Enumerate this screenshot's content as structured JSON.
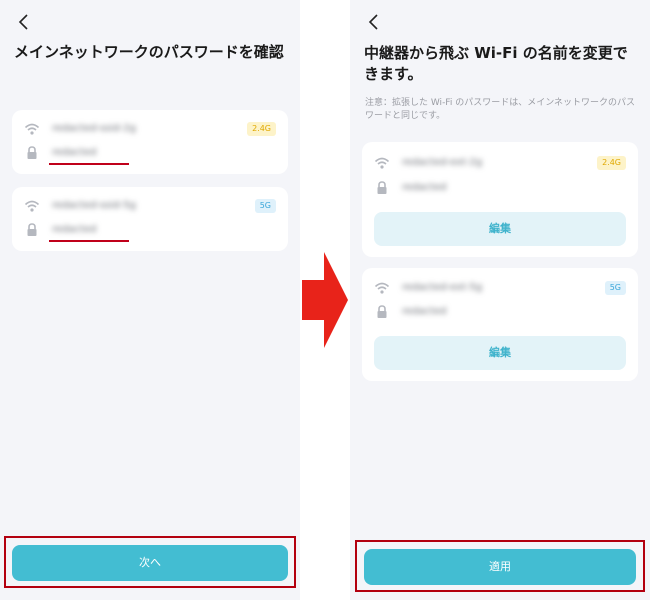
{
  "left_screen": {
    "title": "メインネットワークのパスワードを確認",
    "networks": [
      {
        "ssid": "redacted-ssid-2g",
        "password": "redacted",
        "band": "2.4G"
      },
      {
        "ssid": "redacted-ssid-5g",
        "password": "redacted",
        "band": "5G"
      }
    ],
    "next_label": "次へ"
  },
  "right_screen": {
    "title": "中継器から飛ぶ Wi-Fi の名前を変更できます。",
    "note": "注意：拡張した Wi-Fi のパスワードは、メインネットワークのパスワードと同じです。",
    "networks": [
      {
        "ssid": "redacted-ext-2g",
        "password": "redacted",
        "band": "2.4G",
        "edit_label": "編集"
      },
      {
        "ssid": "redacted-ext-5g",
        "password": "redacted",
        "band": "5G",
        "edit_label": "編集"
      }
    ],
    "apply_label": "適用"
  },
  "icons": [
    "back-chevron-icon",
    "wifi-icon",
    "lock-icon",
    "right-arrow-icon"
  ],
  "colors": {
    "accent": "#43bdd2",
    "highlight": "#b3000f",
    "arrow": "#e8231a",
    "badge_24_text": "#e0a800",
    "badge_5_text": "#3aa6d9"
  }
}
